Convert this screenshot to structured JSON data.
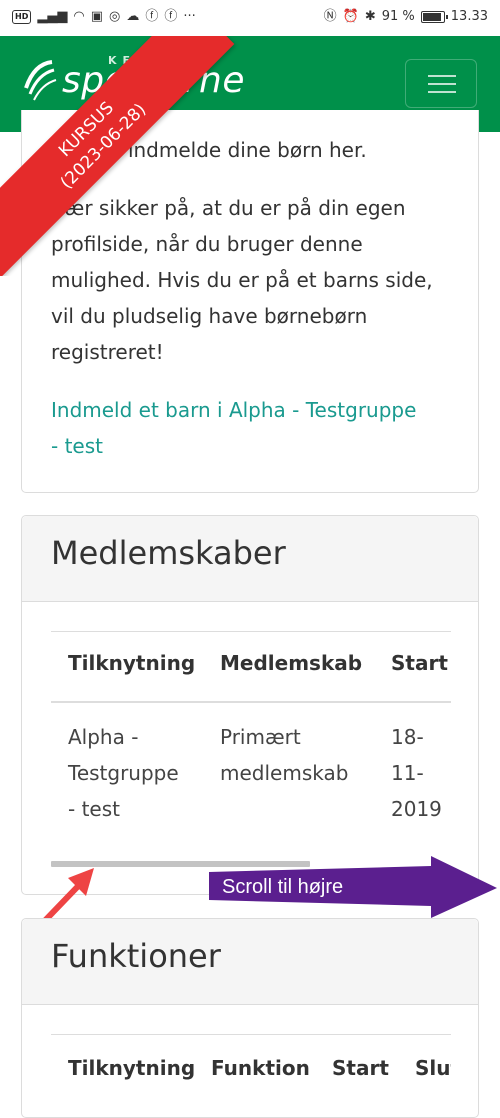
{
  "status_bar": {
    "hd_label": "HD",
    "battery_text": "91 %",
    "time": "13.33",
    "more": "···"
  },
  "navbar": {
    "brand": "spejderne",
    "brand_small": "KFUM"
  },
  "ribbon": {
    "line1": "KURSUS",
    "line2": "(2023-06-28)"
  },
  "intro_card": {
    "partial_text": "Du kan indmelde dine børn her.",
    "warning_lines": [
      "Vær sikker på, at du er på din egen",
      "profilside, når du bruger denne",
      "mulighed. Hvis du er på et barns side,",
      "vil du pludselig have børnebørn",
      "registreret!"
    ],
    "link_lines": [
      "Indmeld et barn i Alpha - Testgruppe",
      "- test"
    ]
  },
  "memberships": {
    "title": "Medlemskaber",
    "headers": [
      "Tilknytning",
      "Medlemskab",
      "Start"
    ],
    "row": {
      "affiliation_lines": [
        "Alpha -",
        "Testgruppe",
        "- test"
      ],
      "membership_lines": [
        "Primært",
        "medlemskab"
      ],
      "start_lines": [
        "18-",
        "11-",
        "2019"
      ]
    }
  },
  "scroll_hint": "Scroll til højre",
  "functions": {
    "title": "Funktioner",
    "headers": [
      "Tilknytning",
      "Funktion",
      "Start",
      "Slut"
    ]
  },
  "colors": {
    "brand_green": "#00904a",
    "ribbon_red": "#e52b2b",
    "link_teal": "#1a9a8f",
    "hint_purple": "#5b1f8f",
    "arrow_red": "#ee4444"
  }
}
